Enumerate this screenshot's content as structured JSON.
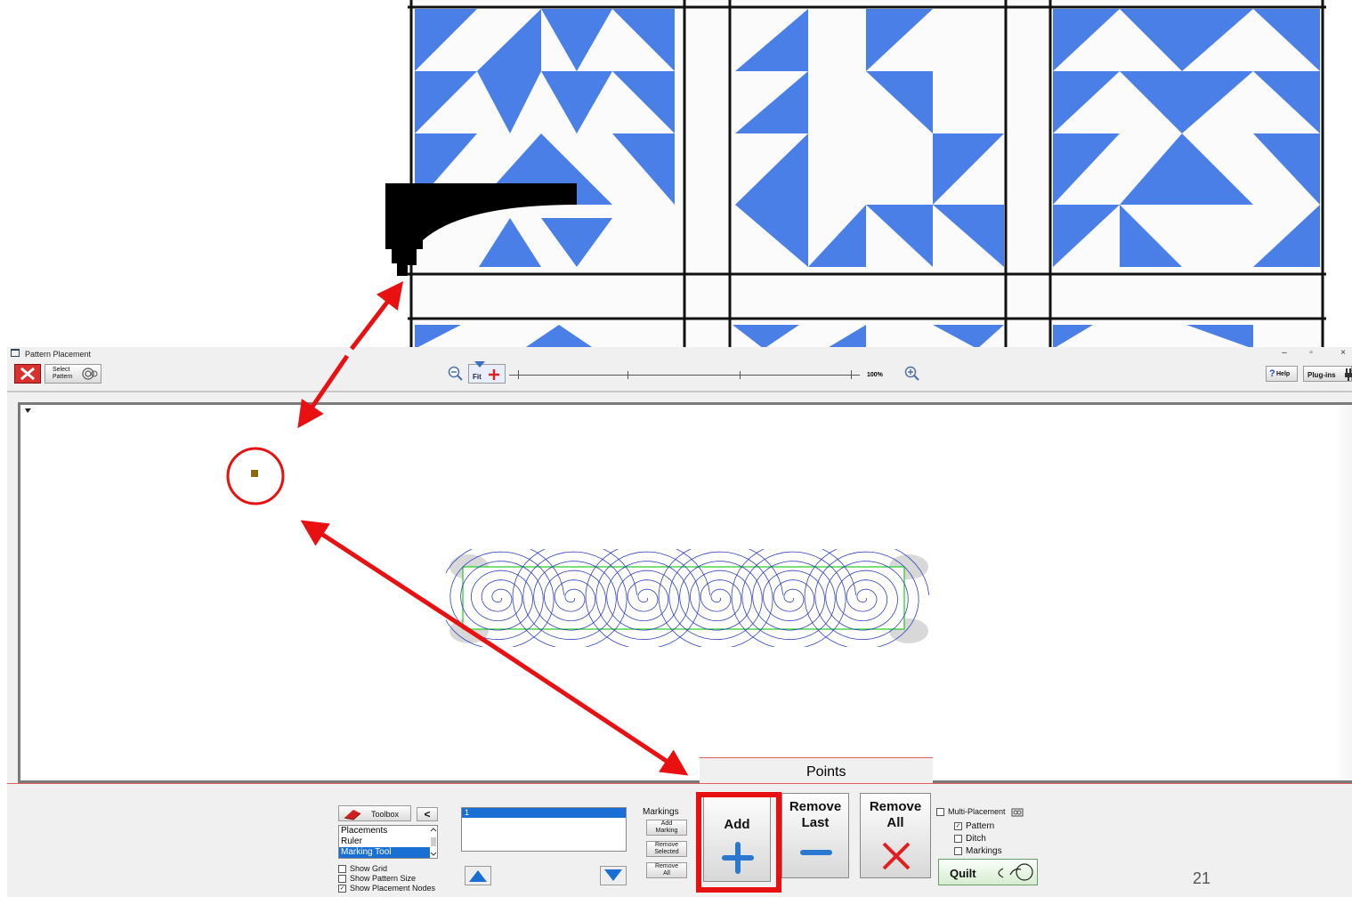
{
  "window": {
    "title": "Pattern Placement",
    "minimize": "–",
    "restore": "▫",
    "close": "×"
  },
  "toolbar": {
    "select_pattern_line1": "Select",
    "select_pattern_line2": "Pattern",
    "fit_label": "Fit",
    "zoom_percent": "100%",
    "help_label": "Help",
    "plugins_label": "Plug-ins"
  },
  "toolbox": {
    "label": "Toolbox",
    "collapse_label": "<",
    "items": [
      "Placements",
      "Ruler",
      "Marking Tool"
    ],
    "selected_item": "Marking Tool"
  },
  "checkboxes": {
    "show_grid": {
      "label": "Show Grid",
      "checked": false
    },
    "show_pattern_size": {
      "label": "Show Pattern Size",
      "checked": false
    },
    "show_placement_nodes": {
      "label": "Show Placement Nodes",
      "checked": true
    }
  },
  "markings": {
    "list_items": [
      "1"
    ],
    "header": "Markings",
    "add_line1": "Add",
    "add_line2": "Marking",
    "remove_selected_line1": "Remove",
    "remove_selected_line2": "Selected",
    "remove_all_line1": "Remove",
    "remove_all_line2": "All"
  },
  "points": {
    "tab_label": "Points",
    "add_label": "Add",
    "remove_last_line1": "Remove",
    "remove_last_line2": "Last",
    "remove_all_line1": "Remove",
    "remove_all_line2": "All"
  },
  "multi_placement": {
    "label": "Multi-Placement",
    "checked": false,
    "pattern": {
      "label": "Pattern",
      "checked": true
    },
    "ditch": {
      "label": "Ditch",
      "checked": false
    },
    "markings": {
      "label": "Markings",
      "checked": false
    },
    "quilt_label": "Quilt"
  },
  "page_number": "21",
  "colors": {
    "quilt_blue": "#4a7fe8",
    "annotation_red": "#e81010",
    "selection_blue": "#1a6fd4",
    "pattern_stroke": "#3040c0",
    "bounding_box": "#22cc22",
    "marker_brown": "#8a6a10"
  }
}
